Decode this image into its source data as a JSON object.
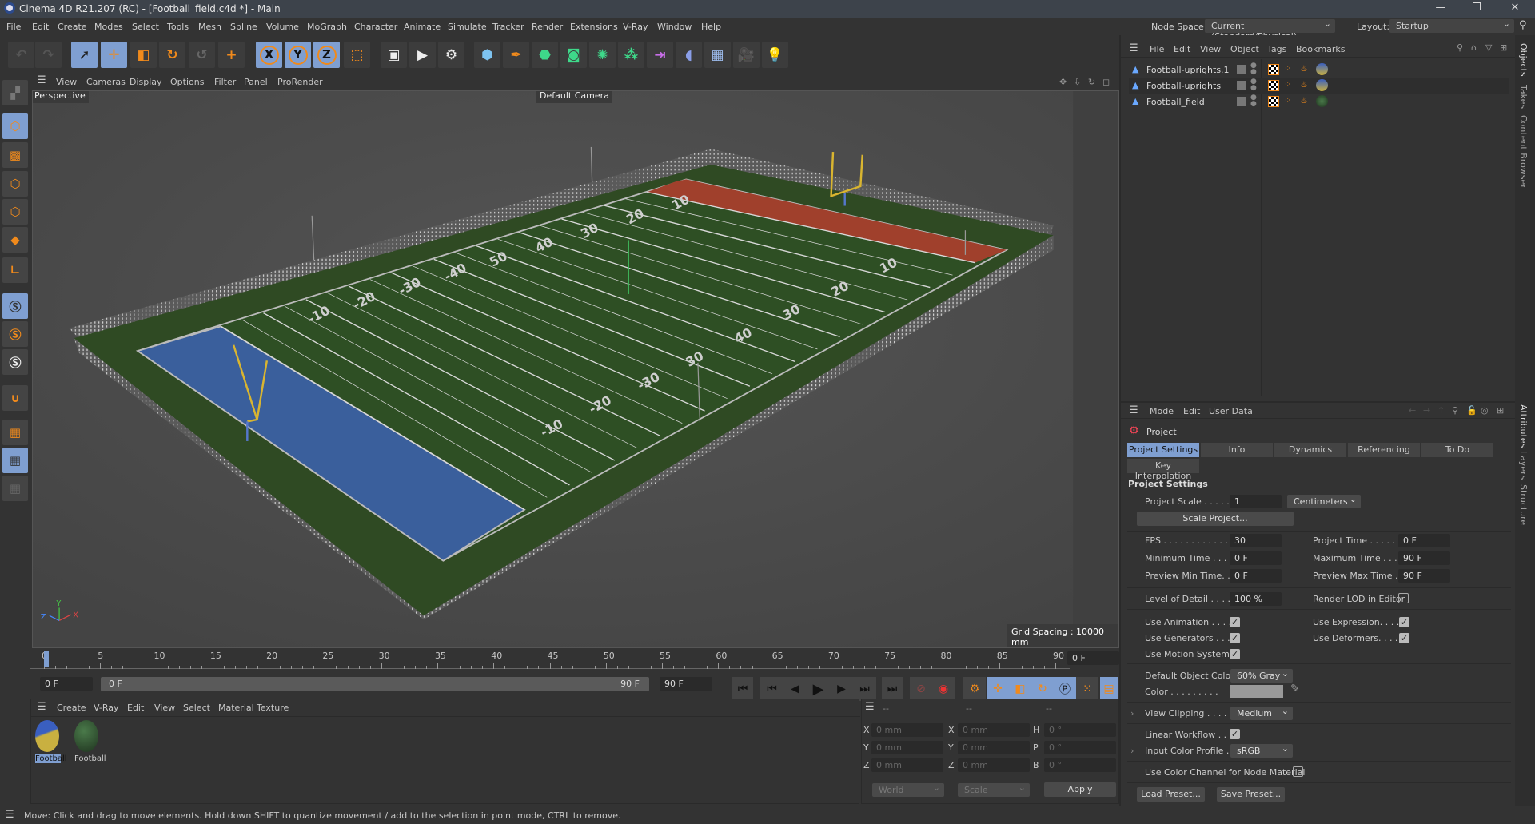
{
  "window": {
    "title": "Cinema 4D R21.207 (RC) - [Football_field.c4d *] - Main",
    "controls": [
      "—",
      "❐",
      "✕"
    ]
  },
  "menu": [
    "File",
    "Edit",
    "Create",
    "Modes",
    "Select",
    "Tools",
    "Mesh",
    "Spline",
    "Volume",
    "MoGraph",
    "Character",
    "Animate",
    "Simulate",
    "Tracker",
    "Render",
    "Extensions",
    "V-Ray",
    "Window",
    "Help"
  ],
  "node_space": {
    "label": "Node Space:",
    "value": "Current (Standard/Physical)"
  },
  "layout": {
    "label": "Layout:",
    "value": "Startup"
  },
  "toolbar": {
    "icons": [
      "undo-icon",
      "redo-icon",
      "select-icon",
      "move-icon",
      "scale-icon",
      "rotate-icon",
      "recent-tool-icon",
      "add-icon",
      "x-axis-icon",
      "y-axis-icon",
      "z-axis-icon",
      "coordinate-system-icon",
      "render-view-icon",
      "render-picture-viewer-icon",
      "render-settings-icon",
      "cube-icon",
      "pen-icon",
      "subdivision-icon",
      "extrude-icon",
      "cloner-icon",
      "array-icon",
      "deformer-icon",
      "floor-icon",
      "sky-icon",
      "camera-icon",
      "light-icon"
    ],
    "axis_labels": [
      "X",
      "Y",
      "Z"
    ]
  },
  "viewport": {
    "menu": [
      "View",
      "Cameras",
      "Display",
      "Options",
      "Filter",
      "Panel",
      "ProRender"
    ],
    "view_name": "Perspective",
    "camera": "Default Camera",
    "grid_spacing": "Grid Spacing : 10000 mm",
    "axis": {
      "x": "X",
      "y": "Y",
      "z": "Z"
    },
    "field_numbers_near": [
      "-10",
      "-20",
      "-30",
      "30",
      "40",
      "30",
      "20",
      "10"
    ],
    "field_numbers_far": [
      "-10",
      "-20",
      "-30",
      "-40",
      "50",
      "40",
      "30",
      "20",
      "10"
    ],
    "colors": {
      "grass": "#2e4f24",
      "endzone_left": "#3a5f9c",
      "endzone_right": "#a0402c",
      "goalpost": "#d9b530"
    }
  },
  "objects_panel": {
    "menu": [
      "File",
      "Edit",
      "View",
      "Object",
      "Tags",
      "Bookmarks"
    ],
    "items": [
      {
        "name": "Football-uprights.1"
      },
      {
        "name": "Football-uprights"
      },
      {
        "name": "Football_field"
      }
    ]
  },
  "side_tabs": {
    "top": [
      "Objects",
      "Takes",
      "Content Browser"
    ],
    "bottom": [
      "Attributes",
      "Layers",
      "Structure"
    ]
  },
  "attributes": {
    "menu": [
      "Mode",
      "Edit",
      "User Data"
    ],
    "object": "Project",
    "tabs": [
      "Project Settings",
      "Info",
      "Dynamics",
      "Referencing",
      "To Do",
      "Key Interpolation"
    ],
    "active_tab": "Project Settings",
    "section": "Project Settings",
    "project_scale": {
      "label": "Project Scale . . . . .",
      "value": "1",
      "unit": "Centimeters"
    },
    "scale_project_button": "Scale Project...",
    "fps": {
      "label": "FPS . . . . . . . . . . . .",
      "value": "30"
    },
    "project_time": {
      "label": "Project Time . . . . .",
      "value": "0 F"
    },
    "min_time": {
      "label": "Minimum Time . . .",
      "value": "0 F"
    },
    "max_time": {
      "label": "Maximum Time . . .",
      "value": "90 F"
    },
    "preview_min": {
      "label": "Preview Min Time. .",
      "value": "0 F"
    },
    "preview_max": {
      "label": "Preview Max Time .",
      "value": "90 F"
    },
    "lod": {
      "label": "Level of Detail . . . .",
      "value": "100 %"
    },
    "render_lod": {
      "label": "Render LOD in Editor",
      "checked": false
    },
    "use_animation": {
      "label": "Use Animation . . . .",
      "checked": true
    },
    "use_expression": {
      "label": "Use Expression. . . .",
      "checked": true
    },
    "use_generators": {
      "label": "Use Generators . . .",
      "checked": true
    },
    "use_deformers": {
      "label": "Use Deformers. . . .",
      "checked": true
    },
    "use_motion": {
      "label": "Use Motion System",
      "checked": true
    },
    "default_color": {
      "label": "Default Object Color",
      "value": "60% Gray"
    },
    "color": {
      "label": "Color . . . . . . . . .",
      "swatch": "#999999"
    },
    "view_clipping": {
      "label": "View Clipping . . . .",
      "value": "Medium"
    },
    "linear_workflow": {
      "label": "Linear Workflow . . .",
      "checked": true
    },
    "input_profile": {
      "label": "Input Color Profile .",
      "value": "sRGB"
    },
    "node_material": {
      "label": "Use Color Channel for Node Material",
      "checked": false
    },
    "load_preset": "Load Preset...",
    "save_preset": "Save Preset..."
  },
  "timeline": {
    "ticks": [
      "0",
      "5",
      "10",
      "15",
      "20",
      "25",
      "30",
      "35",
      "40",
      "45",
      "50",
      "55",
      "60",
      "65",
      "70",
      "75",
      "80",
      "85",
      "90"
    ],
    "current_frame": "0 F",
    "start_field": "0 F",
    "range_start": "0 F",
    "range_end": "90 F",
    "end_field": "90 F",
    "controls": [
      "go-to-start-icon",
      "previous-key-icon",
      "previous-frame-icon",
      "play-icon",
      "next-frame-icon",
      "next-key-icon",
      "go-to-end-icon",
      "record-icon",
      "autokey-icon",
      "keyframe-selection-icon",
      "move-key-icon",
      "scale-key-icon",
      "rotate-key-icon",
      "parameter-key-icon",
      "point-level-icon",
      "timeline-icon"
    ]
  },
  "materials": {
    "menu": [
      "Create",
      "V-Ray",
      "Edit",
      "View",
      "Select",
      "Material",
      "Texture"
    ],
    "items": [
      {
        "name": "Football",
        "selected": true
      },
      {
        "name": "Football",
        "selected": false
      }
    ]
  },
  "coordinates": {
    "header": [
      "--",
      "--",
      "--"
    ],
    "rows": [
      {
        "a": "X",
        "av": "0 mm",
        "b": "X",
        "bv": "0 mm",
        "c": "H",
        "cv": "0 °"
      },
      {
        "a": "Y",
        "av": "0 mm",
        "b": "Y",
        "bv": "0 mm",
        "c": "P",
        "cv": "0 °"
      },
      {
        "a": "Z",
        "av": "0 mm",
        "b": "Z",
        "bv": "0 mm",
        "c": "B",
        "cv": "0 °"
      }
    ],
    "space": "World",
    "mode": "Scale",
    "apply": "Apply"
  },
  "status": "Move: Click and drag to move elements. Hold down SHIFT to quantize movement / add to the selection in point mode, CTRL to remove."
}
